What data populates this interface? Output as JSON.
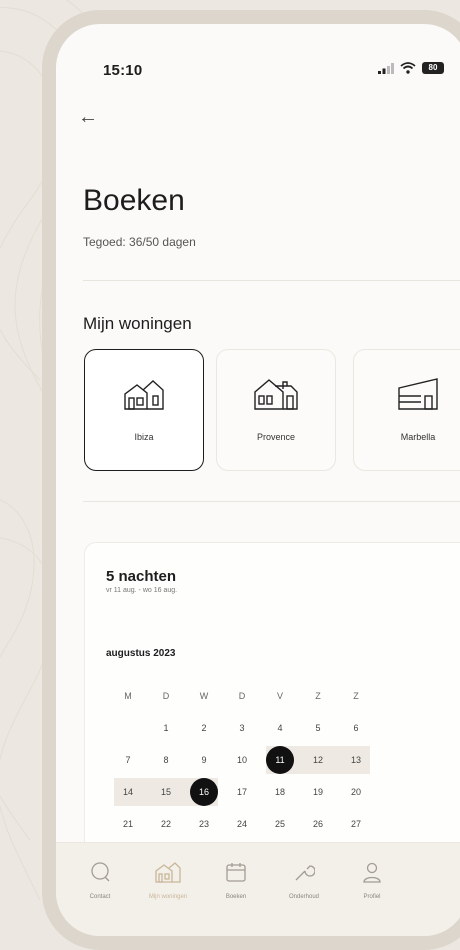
{
  "status": {
    "time": "15:10",
    "battery": "80"
  },
  "page": {
    "title": "Boeken",
    "subtitle": "Tegoed: 36/50 dagen"
  },
  "houses": {
    "title": "Mijn woningen",
    "items": [
      {
        "label": "Ibiza",
        "selected": true
      },
      {
        "label": "Provence",
        "selected": false
      },
      {
        "label": "Marbella",
        "selected": false
      }
    ]
  },
  "booking": {
    "nights": "5 nachten",
    "range": "vr 11 aug. - wo 16 aug.",
    "month": "augustus 2023",
    "weekdays": [
      "M",
      "D",
      "W",
      "D",
      "V",
      "Z",
      "Z"
    ],
    "weeks": [
      [
        "",
        "1",
        "2",
        "3",
        "4",
        "5",
        "6"
      ],
      [
        "7",
        "8",
        "9",
        "10",
        "11",
        "12",
        "13"
      ],
      [
        "14",
        "15",
        "16",
        "17",
        "18",
        "19",
        "20"
      ],
      [
        "21",
        "22",
        "23",
        "24",
        "25",
        "26",
        "27"
      ]
    ],
    "start_day": "11",
    "end_day": "16"
  },
  "tabs": [
    {
      "label": "Contact",
      "icon": "chat-icon"
    },
    {
      "label": "Mijn woningen",
      "icon": "house-icon",
      "active": true
    },
    {
      "label": "Boeken",
      "icon": "calendar-icon"
    },
    {
      "label": "Onderhoud",
      "icon": "wrench-icon"
    },
    {
      "label": "Profiel",
      "icon": "user-icon"
    }
  ]
}
